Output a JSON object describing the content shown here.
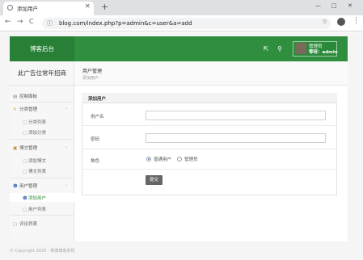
{
  "browser": {
    "tab_title": "添加用户",
    "tab_close": "✕",
    "new_tab": "+",
    "address": "blog.com/index.php?p=admin&c=user&a=add",
    "win_minimize": "—",
    "win_maximize": "□",
    "win_close": "✕",
    "back": "←",
    "forward": "→",
    "reload": "C",
    "star": "☆",
    "menu": "⋮"
  },
  "header": {
    "brand": "博客后台",
    "user_name": "管理员",
    "user_role": "等待：admin"
  },
  "sidebar": {
    "ad": "此广告位常年招商",
    "dashboard": "控制面板",
    "category": "分类管理",
    "category_list": "分类列表",
    "category_add": "添加分类",
    "article": "博文管理",
    "article_add": "添加博文",
    "article_list": "博文列表",
    "user": "用户管理",
    "user_add": "添加用户",
    "user_list": "用户列表",
    "comments": "评论列表"
  },
  "page": {
    "title": "用户管理",
    "subtitle": "添加用户"
  },
  "form": {
    "panel_title": "添加用户",
    "username_label": "用户名",
    "username_value": "",
    "password_label": "密码",
    "password_value": "",
    "role_label": "角色",
    "role_normal": "普通用户",
    "role_admin": "管理员",
    "role_selected": "普通用户",
    "submit": "提交"
  },
  "footer": {
    "copyright": "© Copyright 2020 - 微博博客系统"
  }
}
